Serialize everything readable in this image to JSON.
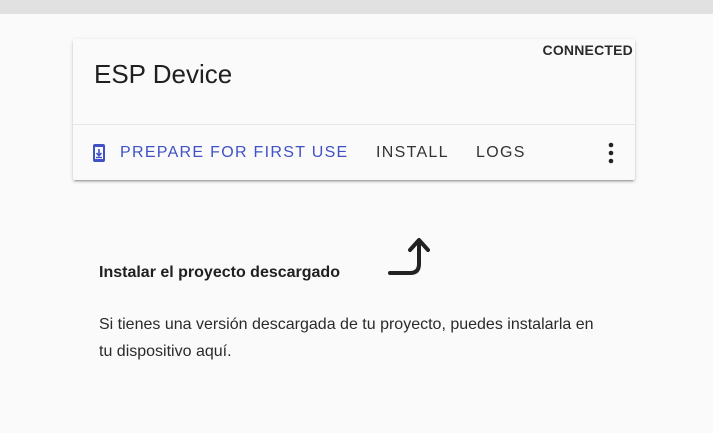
{
  "card": {
    "status": "CONNECTED",
    "title": "ESP Device",
    "actions": {
      "prepare_label": "PREPARE FOR FIRST USE",
      "install_label": "INSTALL",
      "logs_label": "LOGS"
    }
  },
  "section": {
    "title": "Instalar el proyecto descargado",
    "description": "Si tienes una versión descargada de tu proyecto, puedes instalarla en tu dispositivo aquí."
  },
  "icons": {
    "prepare": "phone-download-icon",
    "more": "more-vert-icon",
    "arrow": "curved-arrow-up-icon"
  },
  "colors": {
    "accent": "#3f51c5",
    "text": "#202020",
    "background": "#fafafa"
  }
}
